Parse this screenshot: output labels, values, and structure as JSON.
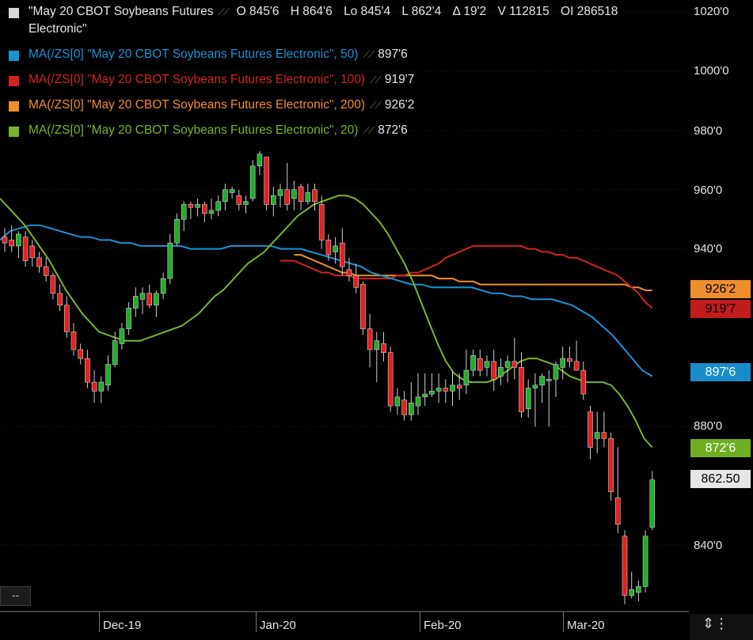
{
  "legend": {
    "main": {
      "name": "\"May 20 CBOT Soybeans Futures",
      "name2": "Electronic\"",
      "open_label": "O",
      "open": "845'6",
      "high_label": "H",
      "high": "864'6",
      "low_label": "Lo",
      "low": "845'4",
      "last_label": "L",
      "last": "862'4",
      "chg_label": "Δ",
      "chg": "19'2",
      "vol_label": "V",
      "vol": "112815",
      "oi_label": "OI",
      "oi": "286518",
      "color": "#d9d9d9"
    },
    "ma": [
      {
        "text": "MA(/ZS[0] \"May 20 CBOT Soybeans Futures Electronic\", 50)",
        "value": "897'6",
        "color": "#1a93d5"
      },
      {
        "text": "MA(/ZS[0] \"May 20 CBOT Soybeans Futures Electronic\", 100)",
        "value": "919'7",
        "color": "#d42222"
      },
      {
        "text": "MA(/ZS[0] \"May 20 CBOT Soybeans Futures Electronic\", 200)",
        "value": "926'2",
        "color": "#ef8e2d"
      },
      {
        "text": "MA(/ZS[0] \"May 20 CBOT Soybeans Futures Electronic\", 20)",
        "value": "872'6",
        "color": "#79b52a"
      }
    ],
    "icon": "wave-icon"
  },
  "tags": {
    "ma200": {
      "label": "926'2",
      "bg": "#ef8e2d",
      "fg": "#000000"
    },
    "ma100": {
      "label": "919'7",
      "bg": "#c21d1d",
      "fg": "#000000"
    },
    "ma50": {
      "label": "897'6",
      "bg": "#1a8ccc",
      "fg": "#ffffff"
    },
    "ma20": {
      "label": "872'6",
      "bg": "#6fae22",
      "fg": "#ffffff"
    },
    "last": {
      "label": "862.50",
      "bg": "#e6e6e6",
      "fg": "#000000"
    }
  },
  "corner_label": "--",
  "chart_data": {
    "type": "candlestick",
    "y_axis": {
      "ticks": [
        "1020'0",
        "1000'0",
        "980'0",
        "960'0",
        "940'0",
        "880'0",
        "840'0"
      ],
      "tick_values": [
        1020,
        1000,
        980,
        960,
        940,
        880,
        840
      ],
      "ylim": [
        818,
        1024
      ]
    },
    "x_axis": {
      "ticks": [
        "Dec-19",
        "Jan-20",
        "Feb-20",
        "Mar-20"
      ],
      "tick_index": [
        12,
        32,
        52,
        72
      ]
    },
    "up_color": "#1fae2a",
    "down_color": "#e52020",
    "candles": [
      {
        "o": 944,
        "h": 947,
        "l": 939,
        "c": 942
      },
      {
        "o": 943,
        "h": 948,
        "l": 939,
        "c": 941
      },
      {
        "o": 941,
        "h": 946,
        "l": 937,
        "c": 945
      },
      {
        "o": 944,
        "h": 946,
        "l": 934,
        "c": 936
      },
      {
        "o": 941,
        "h": 943,
        "l": 934,
        "c": 937
      },
      {
        "o": 937,
        "h": 939,
        "l": 932,
        "c": 934
      },
      {
        "o": 934,
        "h": 937,
        "l": 929,
        "c": 931
      },
      {
        "o": 931,
        "h": 932,
        "l": 923,
        "c": 925
      },
      {
        "o": 925,
        "h": 928,
        "l": 919,
        "c": 921
      },
      {
        "o": 921,
        "h": 924,
        "l": 910,
        "c": 912
      },
      {
        "o": 912,
        "h": 915,
        "l": 904,
        "c": 906
      },
      {
        "o": 906,
        "h": 908,
        "l": 901,
        "c": 903
      },
      {
        "o": 903,
        "h": 906,
        "l": 893,
        "c": 895
      },
      {
        "o": 895,
        "h": 899,
        "l": 888,
        "c": 892
      },
      {
        "o": 892,
        "h": 897,
        "l": 888,
        "c": 895
      },
      {
        "o": 894,
        "h": 904,
        "l": 892,
        "c": 901
      },
      {
        "o": 901,
        "h": 912,
        "l": 900,
        "c": 909
      },
      {
        "o": 908,
        "h": 915,
        "l": 906,
        "c": 913
      },
      {
        "o": 913,
        "h": 922,
        "l": 911,
        "c": 920
      },
      {
        "o": 920,
        "h": 927,
        "l": 917,
        "c": 924
      },
      {
        "o": 923,
        "h": 927,
        "l": 918,
        "c": 925
      },
      {
        "o": 925,
        "h": 928,
        "l": 920,
        "c": 921
      },
      {
        "o": 921,
        "h": 926,
        "l": 917,
        "c": 925
      },
      {
        "o": 925,
        "h": 932,
        "l": 923,
        "c": 930
      },
      {
        "o": 930,
        "h": 945,
        "l": 928,
        "c": 942
      },
      {
        "o": 942,
        "h": 952,
        "l": 941,
        "c": 950
      },
      {
        "o": 950,
        "h": 956,
        "l": 946,
        "c": 955
      },
      {
        "o": 955,
        "h": 956,
        "l": 950,
        "c": 954
      },
      {
        "o": 954,
        "h": 957,
        "l": 951,
        "c": 955
      },
      {
        "o": 955,
        "h": 956,
        "l": 949,
        "c": 952
      },
      {
        "o": 952,
        "h": 957,
        "l": 950,
        "c": 953
      },
      {
        "o": 953,
        "h": 958,
        "l": 951,
        "c": 956
      },
      {
        "o": 956,
        "h": 962,
        "l": 953,
        "c": 960
      },
      {
        "o": 959,
        "h": 961,
        "l": 957,
        "c": 960
      },
      {
        "o": 958,
        "h": 960,
        "l": 953,
        "c": 955
      },
      {
        "o": 955,
        "h": 958,
        "l": 952,
        "c": 956
      },
      {
        "o": 957,
        "h": 970,
        "l": 956,
        "c": 968
      },
      {
        "o": 968,
        "h": 973,
        "l": 965,
        "c": 972
      },
      {
        "o": 971,
        "h": 971,
        "l": 953,
        "c": 955
      },
      {
        "o": 955,
        "h": 961,
        "l": 951,
        "c": 958
      },
      {
        "o": 958,
        "h": 962,
        "l": 954,
        "c": 960
      },
      {
        "o": 960,
        "h": 969,
        "l": 953,
        "c": 955
      },
      {
        "o": 957,
        "h": 963,
        "l": 953,
        "c": 960
      },
      {
        "o": 961,
        "h": 962,
        "l": 953,
        "c": 956
      },
      {
        "o": 956,
        "h": 962,
        "l": 955,
        "c": 959
      },
      {
        "o": 960,
        "h": 962,
        "l": 953,
        "c": 956
      },
      {
        "o": 955,
        "h": 958,
        "l": 940,
        "c": 943
      },
      {
        "o": 943,
        "h": 945,
        "l": 936,
        "c": 938
      },
      {
        "o": 939,
        "h": 944,
        "l": 935,
        "c": 941
      },
      {
        "o": 942,
        "h": 947,
        "l": 931,
        "c": 934
      },
      {
        "o": 933,
        "h": 937,
        "l": 929,
        "c": 931
      },
      {
        "o": 931,
        "h": 935,
        "l": 925,
        "c": 927
      },
      {
        "o": 928,
        "h": 929,
        "l": 911,
        "c": 913
      },
      {
        "o": 913,
        "h": 918,
        "l": 900,
        "c": 906
      },
      {
        "o": 906,
        "h": 912,
        "l": 895,
        "c": 909
      },
      {
        "o": 908,
        "h": 912,
        "l": 902,
        "c": 905
      },
      {
        "o": 905,
        "h": 907,
        "l": 885,
        "c": 887
      },
      {
        "o": 887,
        "h": 893,
        "l": 884,
        "c": 890
      },
      {
        "o": 889,
        "h": 892,
        "l": 882,
        "c": 884
      },
      {
        "o": 884,
        "h": 895,
        "l": 882,
        "c": 888
      },
      {
        "o": 887,
        "h": 898,
        "l": 884,
        "c": 890
      },
      {
        "o": 890,
        "h": 898,
        "l": 887,
        "c": 891
      },
      {
        "o": 891,
        "h": 898,
        "l": 890,
        "c": 892
      },
      {
        "o": 892,
        "h": 898,
        "l": 888,
        "c": 893
      },
      {
        "o": 893,
        "h": 896,
        "l": 888,
        "c": 892
      },
      {
        "o": 892,
        "h": 899,
        "l": 887,
        "c": 894
      },
      {
        "o": 894,
        "h": 898,
        "l": 889,
        "c": 893
      },
      {
        "o": 894,
        "h": 906,
        "l": 891,
        "c": 899
      },
      {
        "o": 899,
        "h": 906,
        "l": 897,
        "c": 904
      },
      {
        "o": 903,
        "h": 906,
        "l": 897,
        "c": 899
      },
      {
        "o": 900,
        "h": 904,
        "l": 897,
        "c": 902
      },
      {
        "o": 902,
        "h": 906,
        "l": 892,
        "c": 896
      },
      {
        "o": 897,
        "h": 903,
        "l": 894,
        "c": 900
      },
      {
        "o": 900,
        "h": 904,
        "l": 895,
        "c": 902
      },
      {
        "o": 902,
        "h": 910,
        "l": 896,
        "c": 900
      },
      {
        "o": 900,
        "h": 905,
        "l": 883,
        "c": 885
      },
      {
        "o": 886,
        "h": 896,
        "l": 883,
        "c": 893
      },
      {
        "o": 893,
        "h": 898,
        "l": 880,
        "c": 894
      },
      {
        "o": 894,
        "h": 898,
        "l": 888,
        "c": 897
      },
      {
        "o": 896,
        "h": 899,
        "l": 880,
        "c": 896
      },
      {
        "o": 896,
        "h": 902,
        "l": 890,
        "c": 901
      },
      {
        "o": 900,
        "h": 907,
        "l": 896,
        "c": 903
      },
      {
        "o": 903,
        "h": 907,
        "l": 900,
        "c": 902
      },
      {
        "o": 902,
        "h": 909,
        "l": 900,
        "c": 899
      },
      {
        "o": 899,
        "h": 902,
        "l": 889,
        "c": 891
      },
      {
        "o": 885,
        "h": 887,
        "l": 869,
        "c": 873
      },
      {
        "o": 876,
        "h": 885,
        "l": 871,
        "c": 878
      },
      {
        "o": 878,
        "h": 885,
        "l": 873,
        "c": 876
      },
      {
        "o": 876,
        "h": 878,
        "l": 855,
        "c": 858
      },
      {
        "o": 856,
        "h": 873,
        "l": 844,
        "c": 847
      },
      {
        "o": 843,
        "h": 845,
        "l": 820,
        "c": 823
      },
      {
        "o": 823,
        "h": 831,
        "l": 822,
        "c": 825
      },
      {
        "o": 824,
        "h": 828,
        "l": 821,
        "c": 826
      },
      {
        "o": 826,
        "h": 845,
        "l": 824,
        "c": 843
      },
      {
        "o": 846,
        "h": 865,
        "l": 845,
        "c": 862
      }
    ],
    "ma20": [
      957,
      954,
      951,
      948,
      944,
      940,
      936,
      931,
      926,
      922,
      918,
      915,
      912,
      911,
      910,
      909,
      909,
      909,
      910,
      911,
      912,
      913,
      914,
      916,
      918,
      921,
      924,
      926,
      929,
      932,
      935,
      937,
      939,
      942,
      945,
      948,
      951,
      953,
      955,
      956,
      957,
      958,
      958,
      957,
      955,
      952,
      949,
      945,
      940,
      935,
      929,
      922,
      915,
      908,
      902,
      898,
      896,
      895,
      895,
      895,
      896,
      898,
      900,
      902,
      903,
      903,
      902,
      901,
      899,
      897,
      896,
      895,
      895,
      895,
      894,
      891,
      887,
      882,
      876,
      873
    ],
    "ma50": [
      943,
      946,
      947,
      948,
      948,
      947,
      946,
      945,
      944,
      944,
      943,
      943,
      942,
      942,
      941,
      941,
      941,
      941,
      941,
      940,
      940,
      940,
      940,
      941,
      941,
      941,
      941,
      941,
      940,
      940,
      940,
      939,
      938,
      937,
      936,
      935,
      934,
      932,
      931,
      930,
      929,
      928,
      928,
      927,
      927,
      927,
      927,
      927,
      926,
      925,
      925,
      924,
      924,
      923,
      923,
      923,
      922,
      921,
      919,
      917,
      914,
      911,
      907,
      903,
      899,
      897
    ],
    "ma100": [
      936,
      936,
      936,
      935,
      934,
      933,
      932,
      932,
      931,
      931,
      931,
      930,
      930,
      930,
      930,
      930,
      930,
      931,
      931,
      932,
      932,
      933,
      934,
      935,
      937,
      938,
      939,
      940,
      941,
      941,
      941,
      941,
      941,
      941,
      941,
      941,
      940,
      940,
      939,
      939,
      938,
      938,
      937,
      937,
      936,
      935,
      934,
      933,
      932,
      931,
      929,
      927,
      925,
      922,
      920
    ],
    "ma200": [
      938,
      938,
      937,
      936,
      935,
      934,
      933,
      932,
      932,
      931,
      931,
      931,
      931,
      931,
      931,
      931,
      931,
      931,
      931,
      931,
      931,
      930,
      930,
      930,
      929,
      929,
      929,
      928,
      928,
      928,
      928,
      928,
      928,
      928,
      928,
      928,
      928,
      928,
      928,
      928,
      928,
      928,
      928,
      928,
      928,
      928,
      928,
      928,
      928,
      927,
      927,
      926,
      926
    ]
  }
}
